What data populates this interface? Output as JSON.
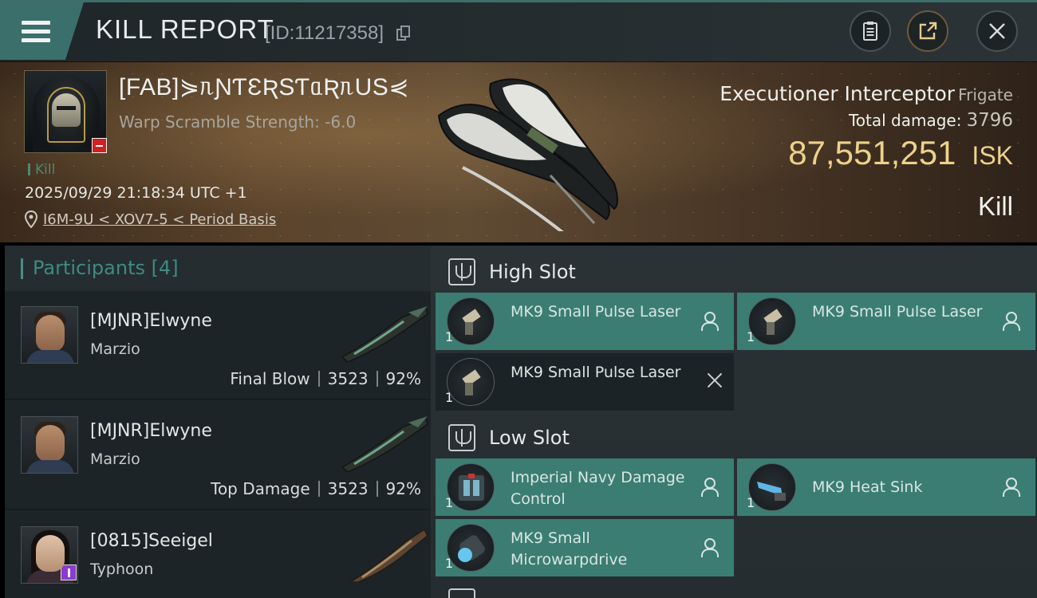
{
  "header": {
    "title": "KILL REPORT",
    "report_id": "[ID:11217358]"
  },
  "victim": {
    "name": "[FAB]⋟ᥰƝƬƐƦSƬᥲƦᥰUS⋞",
    "warp_scramble": "Warp Scramble Strength: -6.0",
    "kill_tag": "Kill",
    "datetime": "2025/09/29 21:18:34 UTC +1",
    "location": "I6M-9U < XOV7-5 < Period Basis",
    "ship_name": "Executioner Interceptor",
    "ship_class": "Frigate",
    "total_damage_label": "Total damage:",
    "total_damage": "3796",
    "isk_value": "87,551,251",
    "isk_unit": "ISK",
    "result": "Kill"
  },
  "participants": {
    "title": "Participants [4]",
    "rows": [
      {
        "name": "[MJNR]Elwyne",
        "ship": "Marzio",
        "role": "Final Blow",
        "damage": "3523",
        "percent": "92%"
      },
      {
        "name": "[MJNR]Elwyne",
        "ship": "Marzio",
        "role": "Top Damage",
        "damage": "3523",
        "percent": "92%"
      },
      {
        "name": "[0815]Seeigel",
        "ship": "Typhoon"
      }
    ]
  },
  "fitting": {
    "high_slot": {
      "title": "High Slot",
      "modules": [
        {
          "name": "MK9 Small Pulse Laser",
          "qty": "1"
        },
        {
          "name": "MK9 Small Pulse Laser",
          "qty": "1"
        },
        {
          "name": "MK9 Small Pulse Laser",
          "qty": "1"
        }
      ]
    },
    "low_slot": {
      "title": "Low Slot",
      "modules": [
        {
          "name": "Imperial Navy Damage Control",
          "qty": "1"
        },
        {
          "name": "MK9 Heat Sink",
          "qty": "1"
        },
        {
          "name": "MK9 Small Microwarpdrive",
          "qty": "1"
        }
      ]
    }
  },
  "colors": {
    "accent_teal": "#3b7d73",
    "isk_gold": "#ecd28a",
    "badge_red": "#cc2222",
    "badge_purple": "#8b3ad0"
  }
}
